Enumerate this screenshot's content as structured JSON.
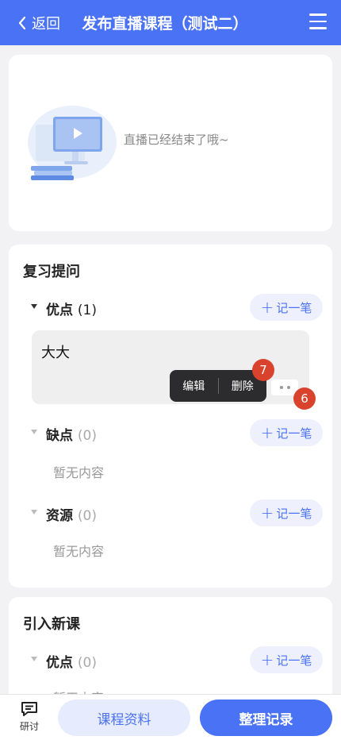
{
  "header": {
    "back_label": "返回",
    "title": "发布直播课程（测试二）"
  },
  "live": {
    "ended_text": "直播已经结束了哦~"
  },
  "review": {
    "title": "复习提问",
    "groups": [
      {
        "label": "优点",
        "count": "(1)",
        "note_label": "记一笔"
      },
      {
        "label": "缺点",
        "count": "(0)",
        "note_label": "记一笔",
        "empty": "暂无内容"
      },
      {
        "label": "资源",
        "count": "(0)",
        "note_label": "记一笔",
        "empty": "暂无内容"
      }
    ],
    "note": {
      "text": "大大",
      "edit_label": "编辑",
      "delete_label": "删除",
      "badge_popup": "7",
      "badge_more": "6"
    }
  },
  "new_lesson": {
    "title": "引入新课",
    "groups": [
      {
        "label": "优点",
        "count": "(0)",
        "note_label": "记一笔",
        "empty": "暂无内容"
      }
    ]
  },
  "bottom": {
    "discuss_label": "研讨",
    "materials_label": "课程资料",
    "organize_label": "整理记录"
  },
  "colors": {
    "primary": "#4a72f5",
    "badge": "#d9432e"
  }
}
